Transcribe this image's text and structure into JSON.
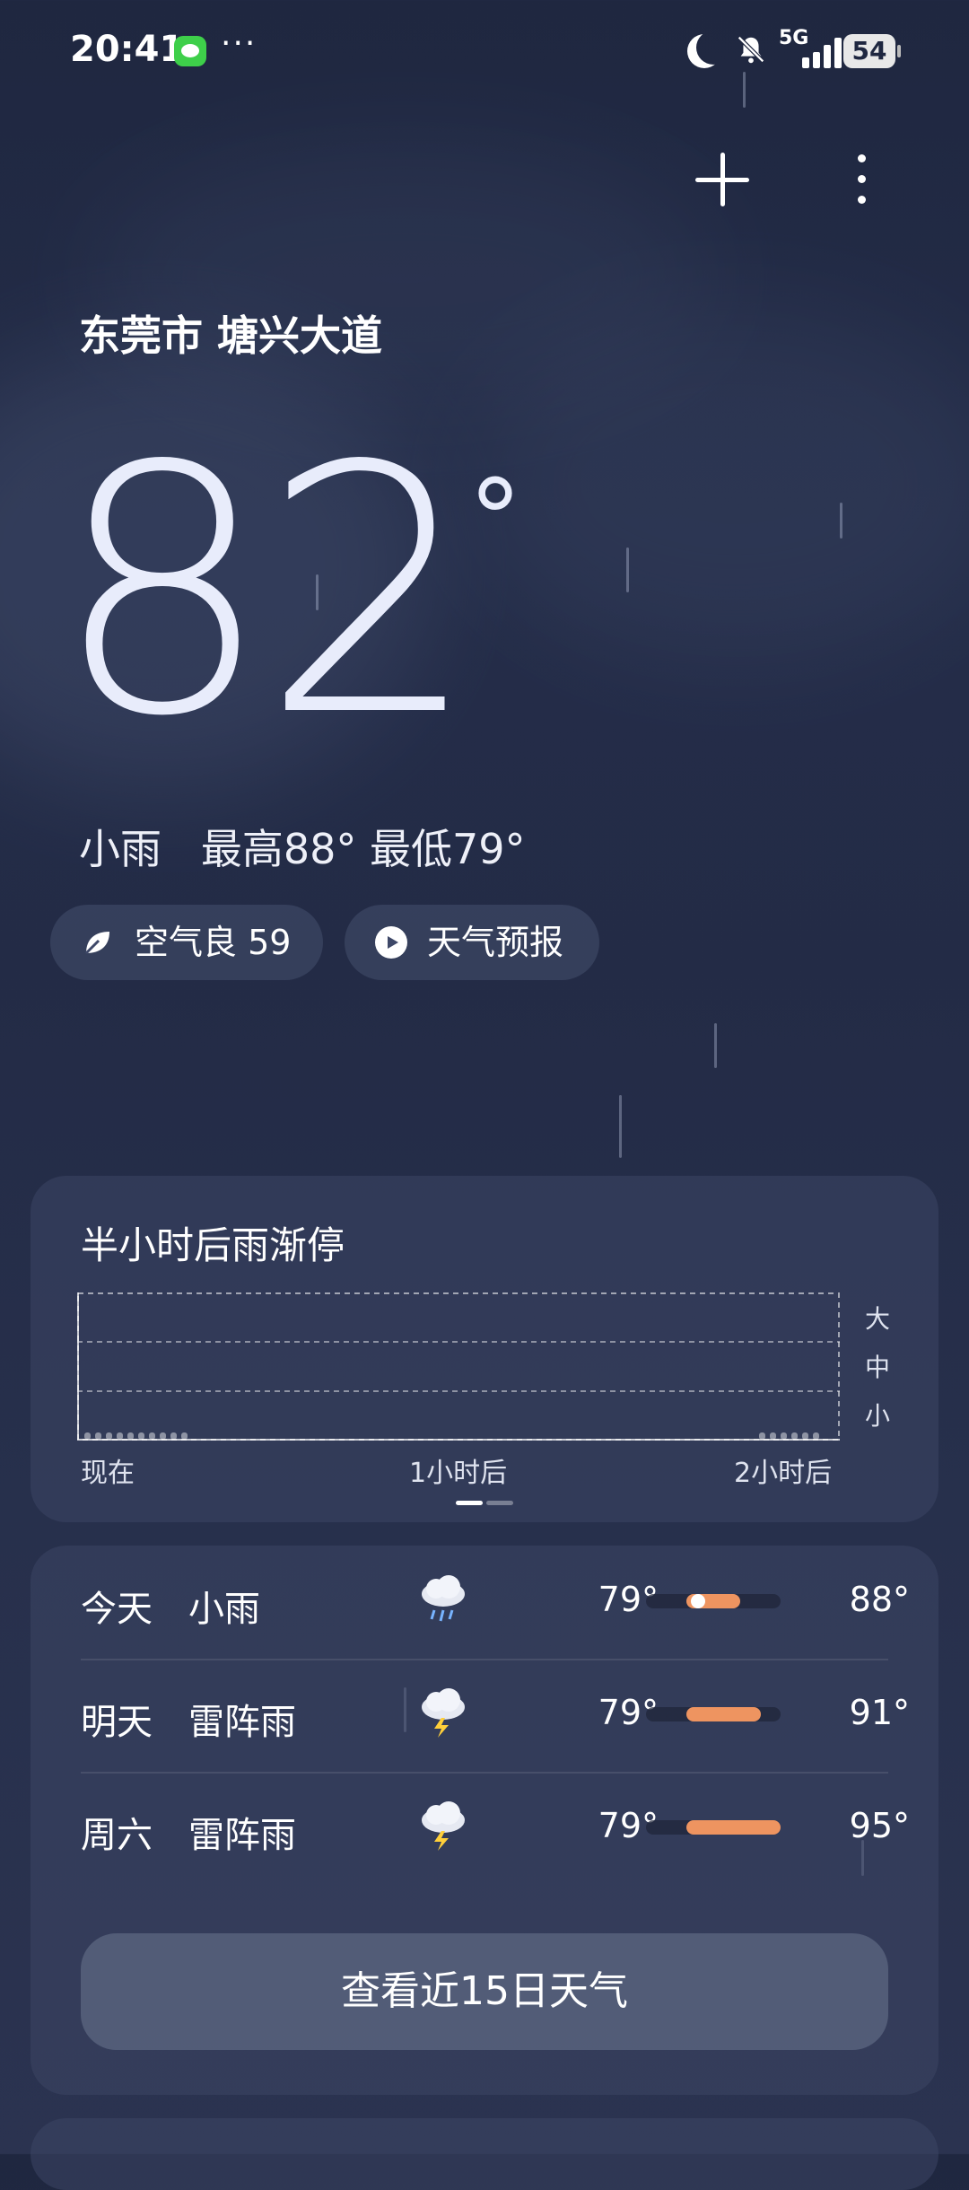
{
  "status_bar": {
    "time": "20:41",
    "network": "5G",
    "battery": "54"
  },
  "location": "东莞市 塘兴大道",
  "current": {
    "temperature": "82",
    "degree": "°",
    "summary": "小雨   最高88° 最低79°"
  },
  "pills": {
    "air_quality": "空气良 59",
    "forecast": "天气预报"
  },
  "rain_card": {
    "title": "半小时后雨渐停",
    "x_labels": [
      "现在",
      "1小时后",
      "2小时后"
    ],
    "y_labels": [
      "大",
      "中",
      "小"
    ]
  },
  "forecast": [
    {
      "day": "今天",
      "desc": "小雨",
      "icon": "cloud-rain-icon",
      "low": "79°",
      "high": "88°",
      "range_start": 0.3,
      "range_end": 0.7
    },
    {
      "day": "明天",
      "desc": "雷阵雨",
      "icon": "thunderstorm-icon",
      "low": "79°",
      "high": "91°",
      "range_start": 0.3,
      "range_end": 0.85
    },
    {
      "day": "周六",
      "desc": "雷阵雨",
      "icon": "thunderstorm-icon",
      "low": "79°",
      "high": "95°",
      "range_start": 0.3,
      "range_end": 1.0
    }
  ],
  "forecast_button": "查看近15日天气",
  "colors": {
    "bar_fill": "#ee9460",
    "accent_green": "#3ecf4a"
  }
}
